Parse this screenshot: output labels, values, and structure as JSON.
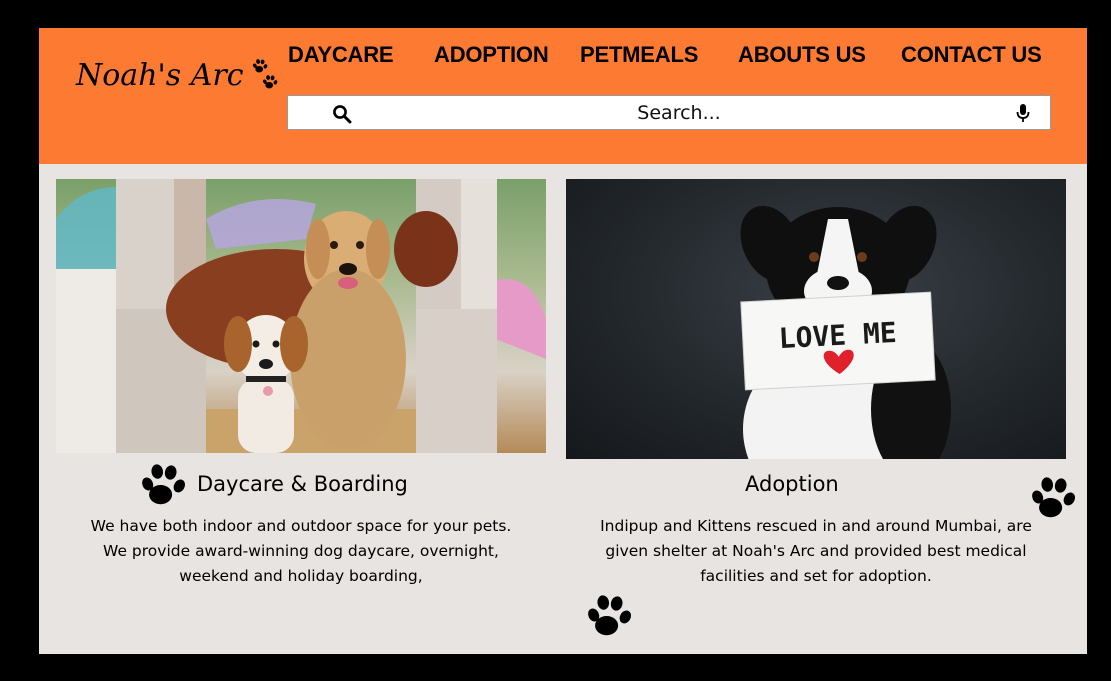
{
  "brand": {
    "name": "Noah's Arc"
  },
  "nav": {
    "items": [
      {
        "id": "daycare",
        "label": "DAYCARE"
      },
      {
        "id": "adoption",
        "label": "ADOPTION"
      },
      {
        "id": "petmeals",
        "label": "PETMEALS"
      },
      {
        "id": "about",
        "label": "ABOUTS US"
      },
      {
        "id": "contact",
        "label": "CONTACT US"
      }
    ]
  },
  "search": {
    "placeholder": "Search..."
  },
  "cards": {
    "daycare": {
      "title": "Daycare & Boarding",
      "lines": [
        "We have both indoor and outdoor space for your pets.",
        "We provide award-winning dog daycare, overnight,",
        "weekend and holiday boarding,"
      ]
    },
    "adoption": {
      "title": "Adoption",
      "sign_text": "LOVE ME",
      "lines": [
        "Indipup and Kittens rescued in and  around Mumbai, are",
        "given shelter at Noah's Arc and provided best medical",
        "facilities and set for adoption."
      ]
    }
  },
  "icons": {
    "paw": "paw-print-icon",
    "search": "magnifier-icon",
    "mic": "microphone-icon"
  },
  "colors": {
    "header": "#fd7a33",
    "page": "#e7e4e1",
    "frame": "#000000"
  }
}
